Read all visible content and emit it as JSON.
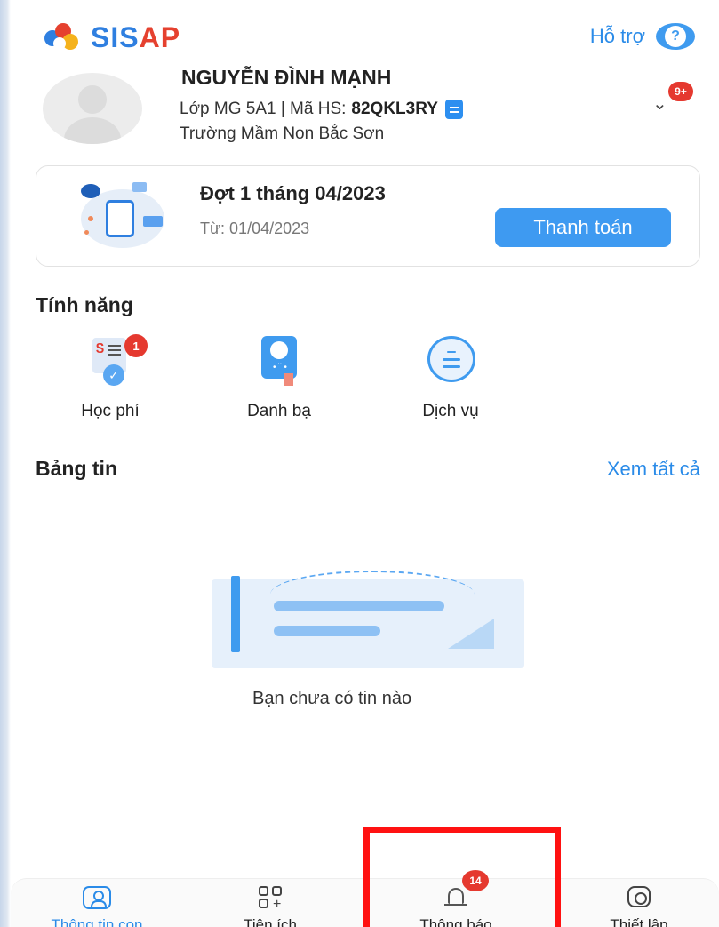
{
  "header": {
    "logo_text_a": "SIS",
    "logo_text_b": "AP",
    "support_label": "Hỗ trợ",
    "support_icon": "help-chat-icon"
  },
  "profile": {
    "name": "NGUYỄN ĐÌNH MẠNH",
    "class_prefix": "Lớp MG 5A1 | Mã HS:",
    "student_code": "82QKL3RY",
    "school": "Trường Mầm Non Bắc Sơn",
    "notification_badge": "9+"
  },
  "payment": {
    "title": "Đợt 1 tháng 04/2023",
    "date": "Từ: 01/04/2023",
    "button": "Thanh toán"
  },
  "features": {
    "title": "Tính năng",
    "items": [
      {
        "label": "Học phí",
        "icon": "tuition-icon",
        "badge": "1"
      },
      {
        "label": "Danh bạ",
        "icon": "contacts-icon"
      },
      {
        "label": "Dịch vụ",
        "icon": "services-icon"
      }
    ]
  },
  "news": {
    "title": "Bảng tin",
    "see_all": "Xem tất cả",
    "empty_text": "Bạn chưa có tin nào"
  },
  "bottom_nav": [
    {
      "label": "Thông tin con",
      "icon": "child-profile-icon",
      "active": true
    },
    {
      "label": "Tiện ích",
      "icon": "utilities-icon"
    },
    {
      "label": "Thông báo",
      "icon": "bell-icon",
      "badge": "14"
    },
    {
      "label": "Thiết lập",
      "icon": "settings-icon"
    }
  ],
  "colors": {
    "primary": "#3e9af1",
    "badge": "#e5392f",
    "highlight": "#ff1111"
  }
}
